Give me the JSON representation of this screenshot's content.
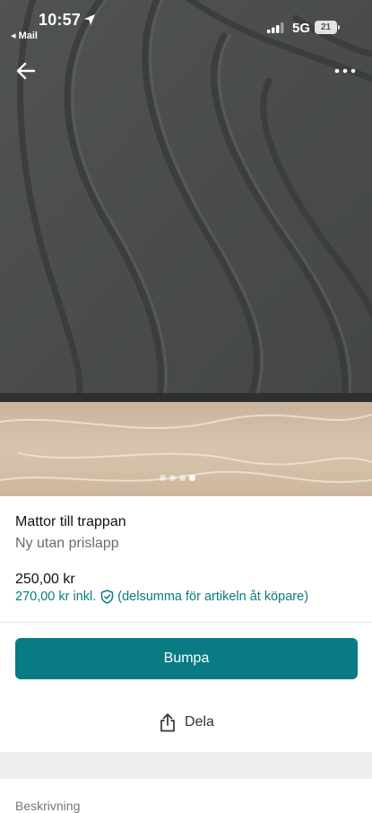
{
  "status_bar": {
    "time": "10:57",
    "back_app": "◂ Mail",
    "network": "5G",
    "battery": "21"
  },
  "listing": {
    "photo_icon": "rug-photo",
    "carousel": {
      "count": 4,
      "active_index": 3
    },
    "title": "Mattor till trappan",
    "condition": "Ny utan prislapp",
    "price": "250,00 kr",
    "price_incl": "270,00 kr inkl.",
    "price_incl_note": "(delsumma för artikeln åt köpare)"
  },
  "actions": {
    "bump_label": "Bumpa",
    "share_label": "Dela"
  },
  "description": {
    "heading": "Beskrivning"
  },
  "colors": {
    "accent": "#087b84",
    "link": "#0b7a82"
  }
}
